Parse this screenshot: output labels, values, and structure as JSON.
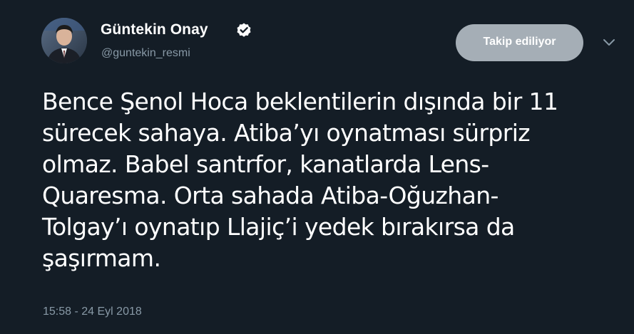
{
  "tweet": {
    "author": {
      "display_name": "Güntekin Onay",
      "username": "@guntekin_resmi",
      "verified": true,
      "avatar_icon": "profile-photo"
    },
    "follow_button_label": "Takip ediliyor",
    "menu_icon": "chevron-down-icon",
    "text": "Bence Şenol Hoca beklentilerin dışında bir 11\nsürecek sahaya. Atiba’yı oynatması sürpriz\nolmaz. Babel santrfor, kanatlarda Lens-\nQuaresma. Orta sahada Atiba-Oğuzhan-\nTolgay’ı oynatıp Llajiç’i yedek bırakırsa da\nşaşırmam.",
    "timestamp": "15:58 - 24 Eyl 2018"
  },
  "colors": {
    "background": "#141d26",
    "text": "#ffffff",
    "secondary_text": "#8899a6",
    "button_bg": "#a5aeb6",
    "verified_badge": "#ffffff"
  }
}
